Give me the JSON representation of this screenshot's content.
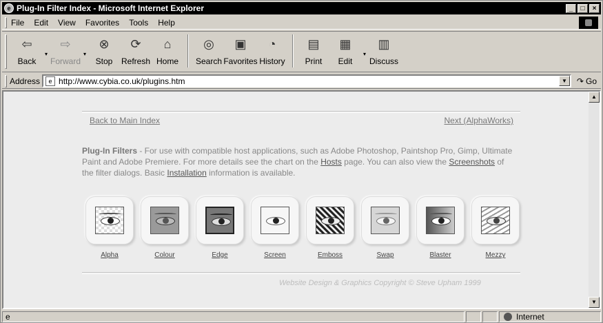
{
  "window": {
    "title": "Plug-In Filter Index - Microsoft Internet Explorer",
    "controls": [
      "_",
      "□",
      "×"
    ]
  },
  "menubar": {
    "items": [
      {
        "label": "File"
      },
      {
        "label": "Edit"
      },
      {
        "label": "View"
      },
      {
        "label": "Favorites"
      },
      {
        "label": "Tools"
      },
      {
        "label": "Help"
      }
    ]
  },
  "toolbar": {
    "back": "Back",
    "forward": "Forward",
    "stop": "Stop",
    "refresh": "Refresh",
    "home": "Home",
    "search": "Search",
    "favorites": "Favorites",
    "history": "History",
    "print": "Print",
    "edit": "Edit",
    "discuss": "Discuss"
  },
  "addressbar": {
    "label": "Address",
    "url": "http://www.cybia.co.uk/plugins.htm",
    "go": "Go"
  },
  "page": {
    "back_link": "Back to Main Index",
    "next_link": "Next (AlphaWorks)",
    "intro_title": "Plug-In Filters",
    "intro_1": " - For use with compatible host applications, such as Adobe Photoshop, Paintshop Pro, Gimp, Ultimate Paint and Adobe Premiere. For more details see the chart on the ",
    "hosts_link": "Hosts",
    "intro_2": " page. You can also view the ",
    "screenshots_link": "Screenshots",
    "intro_3": " of the filter dialogs. Basic ",
    "installation_link": "Installation",
    "intro_4": " information is available.",
    "filters": [
      {
        "label": "Alpha"
      },
      {
        "label": "Colour"
      },
      {
        "label": "Edge"
      },
      {
        "label": "Screen"
      },
      {
        "label": "Emboss"
      },
      {
        "label": "Swap"
      },
      {
        "label": "Blaster"
      },
      {
        "label": "Mezzy"
      }
    ],
    "copyright": "Website Design & Graphics Copyright © Steve Upham 1999"
  },
  "statusbar": {
    "zone": "Internet"
  }
}
